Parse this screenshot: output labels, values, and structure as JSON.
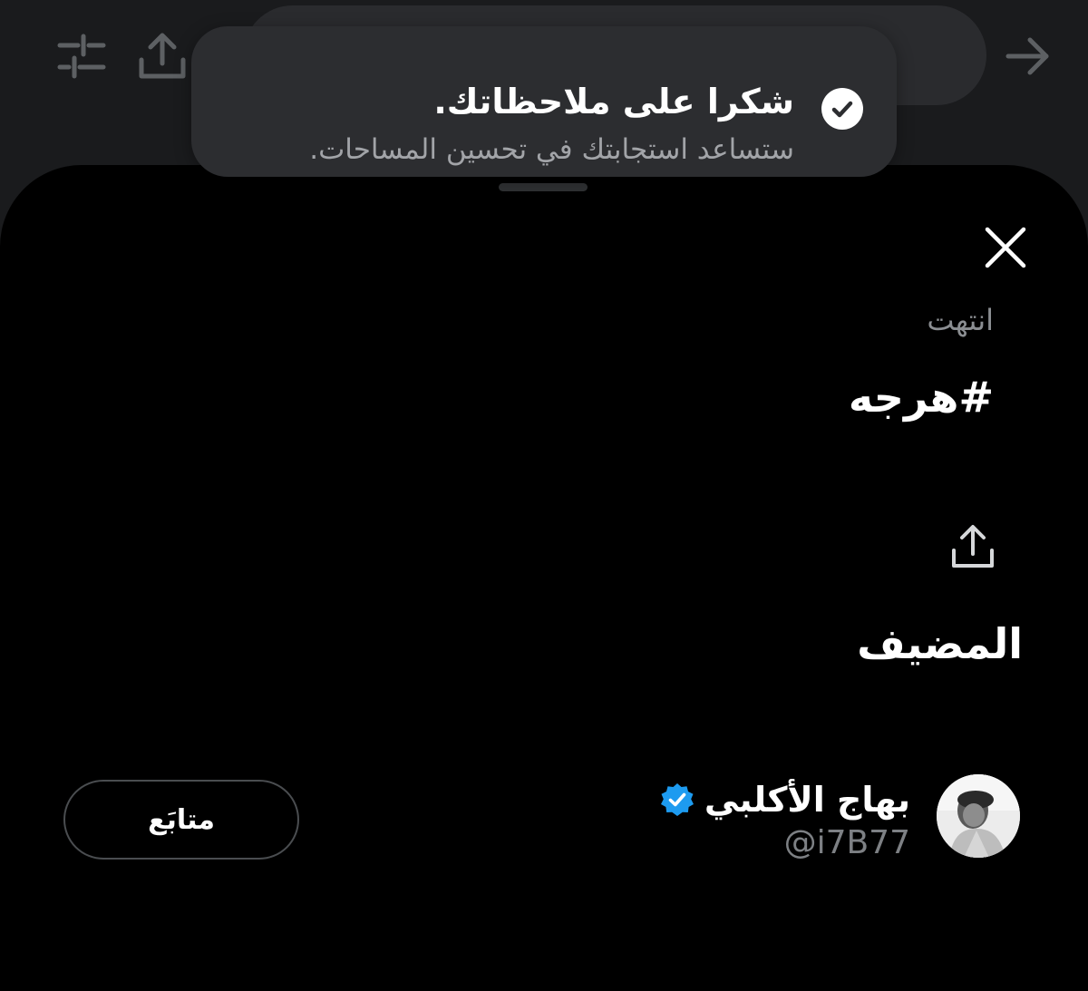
{
  "background": {
    "icons": [
      "filter-sliders-icon",
      "share-icon",
      "arrow-right-icon"
    ]
  },
  "toast": {
    "title": "شكرا على ملاحظاتك.",
    "subtitle": "ستساعد استجابتك في تحسين المساحات.",
    "icon": "check-circle-icon"
  },
  "sheet": {
    "status": "انتهت",
    "space_title": "#هرجه",
    "host_heading": "المضيف",
    "icons": [
      "close-icon",
      "share-icon"
    ],
    "host": {
      "name": "بهاج الأكلبي",
      "handle": "@i7B77",
      "verified": true,
      "follow_label": "متابَع"
    }
  },
  "colors": {
    "sheet_background": "#000000",
    "toast_background": "#2c2d30",
    "verified_blue": "#1d9bf0",
    "secondary_text": "#7d8084"
  }
}
